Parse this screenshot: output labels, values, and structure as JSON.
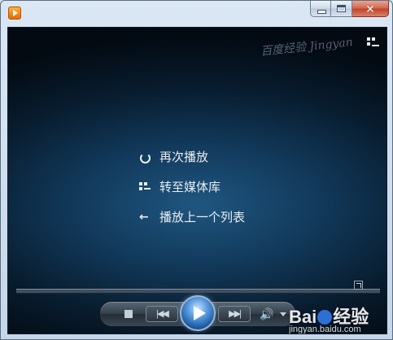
{
  "window": {
    "close_glyph": "✕"
  },
  "watermark": {
    "top_text": "百度经验 Jingyan",
    "logo_text_a": "Bai",
    "logo_text_b": "经验",
    "url": "jingyan.baidu.com"
  },
  "menu": {
    "items": [
      {
        "label": "再次播放",
        "icon": "replay-icon"
      },
      {
        "label": "转至媒体库",
        "icon": "library-icon"
      },
      {
        "label": "播放上一个列表",
        "icon": "back-arrow-icon"
      }
    ]
  },
  "controls": {
    "prev_glyph": "|◀◀",
    "next_glyph": "▶▶|",
    "volume_glyph": "🔊"
  },
  "colors": {
    "screen_center": "#1f5680",
    "screen_edge": "#030a12",
    "play_button": "#1d5ea8",
    "close_button": "#c2432a",
    "app_icon": "#e86a00"
  }
}
